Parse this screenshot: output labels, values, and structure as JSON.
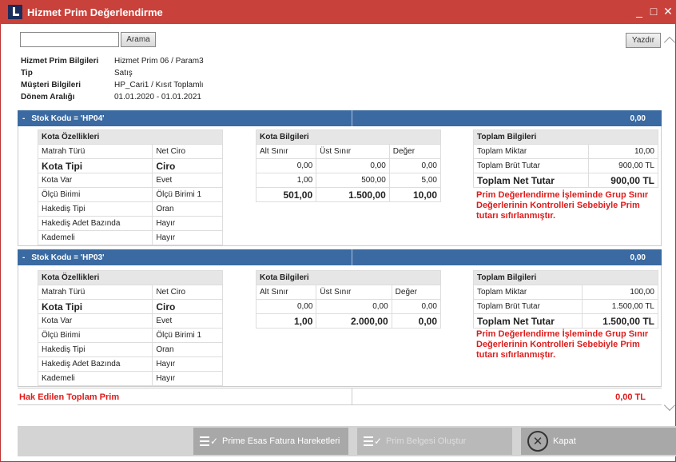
{
  "window": {
    "title": "Hizmet Prim Değerlendirme",
    "minimize": "_",
    "maximize": "□",
    "close": "✕"
  },
  "toolbar": {
    "search_value": "",
    "search_label": "Arama",
    "print_label": "Yazdır"
  },
  "info": [
    {
      "label": "Hizmet Prim Bilgileri",
      "value": "Hizmet Prim 06 / Param3"
    },
    {
      "label": "Tip",
      "value": "Satış"
    },
    {
      "label": "Müşteri Bilgileri",
      "value": "HP_Cari1 / Kısıt Toplamlı"
    },
    {
      "label": "Dönem Aralığı",
      "value": "01.01.2020 - 01.01.2021"
    }
  ],
  "sections": [
    {
      "header": "Stok Kodu = 'HP04'",
      "dash": "-",
      "total": "0,00",
      "quota_features": {
        "title": "Kota Özellikleri",
        "rows": [
          [
            "Matrah Türü",
            "Net Ciro"
          ],
          [
            "Kota Tipi",
            "Ciro"
          ],
          [
            "Kota Var",
            "Evet"
          ],
          [
            "Ölçü Birimi",
            "Ölçü Birimi 1"
          ],
          [
            "Hakediş Tipi",
            "Oran"
          ],
          [
            "Hakediş Adet Bazında",
            "Hayır"
          ],
          [
            "Kademeli",
            "Hayır"
          ]
        ]
      },
      "quota_info": {
        "title": "Kota Bilgileri",
        "columns": [
          "Alt Sınır",
          "Üst Sınır",
          "Değer"
        ],
        "rows": [
          [
            "0,00",
            "0,00",
            "0,00"
          ],
          [
            "1,00",
            "500,00",
            "5,00"
          ]
        ],
        "total": [
          "501,00",
          "1.500,00",
          "10,00"
        ]
      },
      "totals": {
        "title": "Toplam Bilgileri",
        "rows": [
          [
            "Toplam Miktar",
            "10,00"
          ],
          [
            "Toplam Brüt Tutar",
            "900,00 TL"
          ]
        ],
        "net": [
          "Toplam Net Tutar",
          "900,00 TL"
        ],
        "warning": "Prim Değerlendirme İşleminde Grup Sınır Değerlerinin Kontrolleri Sebebiyle Prim tutarı sıfırlanmıştır."
      }
    },
    {
      "header": "Stok Kodu = 'HP03'",
      "dash": "-",
      "total": "0,00",
      "quota_features": {
        "title": "Kota Özellikleri",
        "rows": [
          [
            "Matrah Türü",
            "Net Ciro"
          ],
          [
            "Kota Tipi",
            "Ciro"
          ],
          [
            "Kota Var",
            "Evet"
          ],
          [
            "Ölçü Birimi",
            "Ölçü Birimi 1"
          ],
          [
            "Hakediş Tipi",
            "Oran"
          ],
          [
            "Hakediş Adet Bazında",
            "Hayır"
          ],
          [
            "Kademeli",
            "Hayır"
          ]
        ]
      },
      "quota_info": {
        "title": "Kota Bilgileri",
        "columns": [
          "Alt Sınır",
          "Üst Sınır",
          "Değer"
        ],
        "rows": [
          [
            "0,00",
            "0,00",
            "0,00"
          ]
        ],
        "total": [
          "1,00",
          "2.000,00",
          "0,00"
        ]
      },
      "totals": {
        "title": "Toplam Bilgileri",
        "rows": [
          [
            "Toplam Miktar",
            "100,00"
          ],
          [
            "Toplam Brüt Tutar",
            "1.500,00 TL"
          ]
        ],
        "net": [
          "Toplam Net Tutar",
          "1.500,00 TL"
        ],
        "warning": "Prim Değerlendirme İşleminde Grup Sınır Değerlerinin Kontrolleri Sebebiyle Prim tutarı sıfırlanmıştır."
      }
    }
  ],
  "grand_total": {
    "label": "Hak Edilen Toplam Prim",
    "value": "0,00 TL"
  },
  "actions": {
    "invoice_moves": "Prime Esas Fatura Hareketleri",
    "create_doc": "Prim Belgesi Oluştur",
    "close": "Kapat"
  },
  "colors": {
    "titlebar": "#c8413a",
    "section_header": "#3a6aa1",
    "warning": "#e01b1b"
  }
}
